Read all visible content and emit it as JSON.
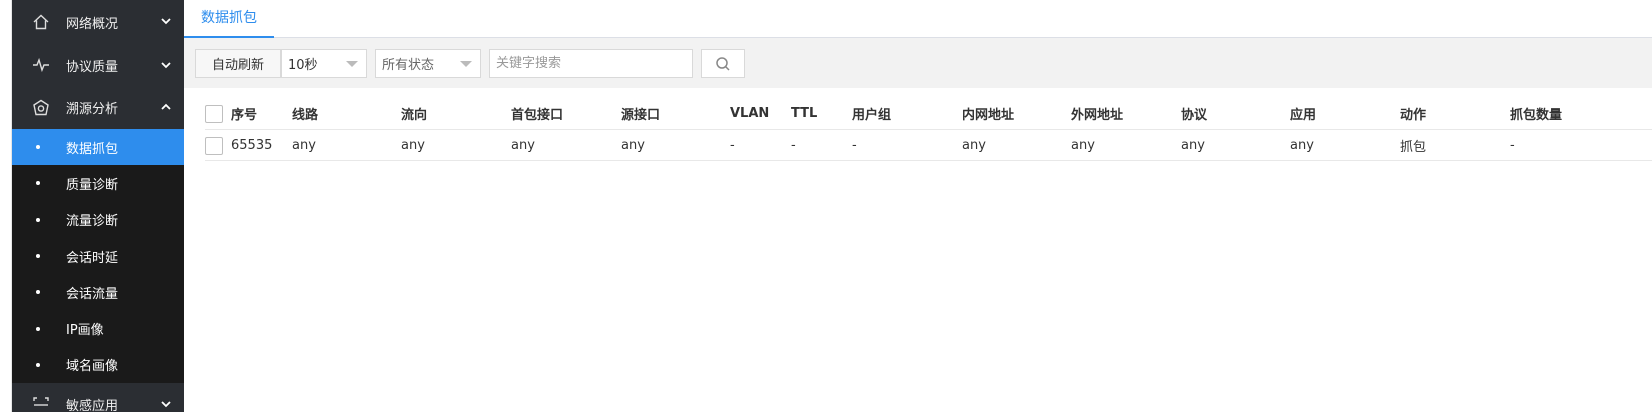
{
  "sidebar": {
    "groups": [
      {
        "label": "网络概况",
        "icon": "home-icon"
      },
      {
        "label": "协议质量",
        "icon": "pulse-icon"
      },
      {
        "label": "溯源分析",
        "icon": "shield-icon"
      }
    ],
    "subitems": [
      "数据抓包",
      "质量诊断",
      "流量诊断",
      "会话时延",
      "会话流量",
      "IP画像",
      "域名画像"
    ],
    "last_group": {
      "label": "敏感应用",
      "icon": "scan-icon"
    }
  },
  "tabs": [
    {
      "label": "数据抓包"
    }
  ],
  "toolbar": {
    "refresh_label": "自动刷新",
    "interval_value": "10秒",
    "status_value": "所有状态",
    "search_placeholder": "关键字搜索"
  },
  "table": {
    "headers": [
      "序号",
      "线路",
      "流向",
      "首包接口",
      "源接口",
      "VLAN",
      "TTL",
      "用户组",
      "内网地址",
      "外网地址",
      "协议",
      "应用",
      "动作",
      "抓包数量"
    ],
    "rows": [
      [
        "65535",
        "any",
        "any",
        "any",
        "any",
        "-",
        "-",
        "-",
        "any",
        "any",
        "any",
        "any",
        "抓包",
        "-"
      ]
    ]
  },
  "colors": {
    "accent": "#2e8ded",
    "sidebar_bg": "#2b2e33",
    "submenu_bg": "#1a1a1a"
  }
}
